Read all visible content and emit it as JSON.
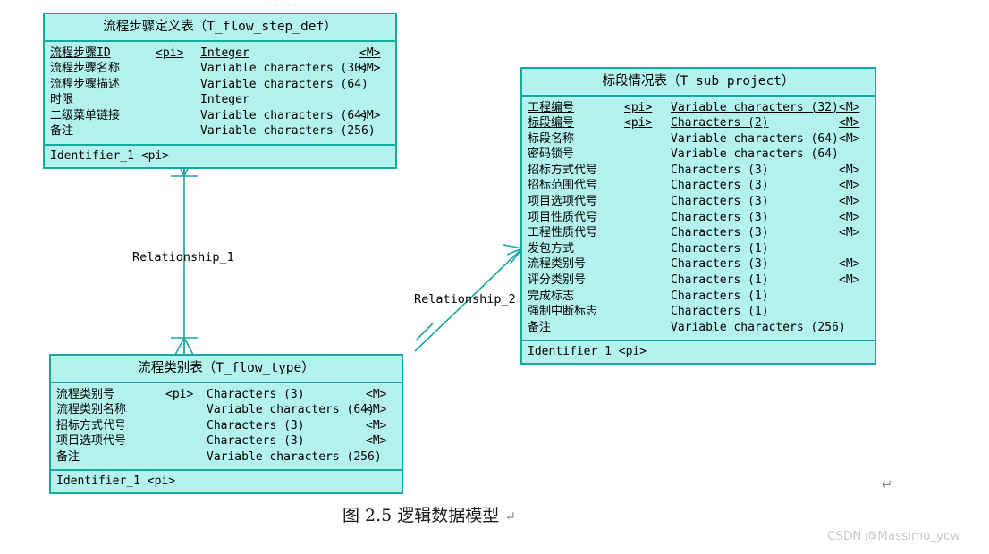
{
  "figure": {
    "caption": "图 2.5 逻辑数据模型",
    "caption_mark": "↵",
    "stray_mark": "↵",
    "watermark": "CSDN @Massimo_ycw",
    "colors": {
      "entity_fill": "#b4f2ee",
      "entity_border": "#17a8a0",
      "relationship_line": "#17a8a0",
      "text": "#000000",
      "watermark_text": "#c8c8c8"
    }
  },
  "entities": [
    {
      "id": "t_flow_step_def",
      "title": "流程步骤定义表（T_flow_step_def）",
      "identifier": "Identifier_1  <pi>",
      "attributes": [
        {
          "name": "流程步骤ID",
          "pi": "<pi>",
          "type": "Integer",
          "m": "<M>",
          "underline": true
        },
        {
          "name": "流程步骤名称",
          "pi": "",
          "type": "Variable characters (30)",
          "m": "<M>",
          "underline": false
        },
        {
          "name": "流程步骤描述",
          "pi": "",
          "type": "Variable characters (64)",
          "m": "",
          "underline": false
        },
        {
          "name": "时限",
          "pi": "",
          "type": "Integer",
          "m": "",
          "underline": false
        },
        {
          "name": "二级菜单链接",
          "pi": "",
          "type": "Variable characters (64)",
          "m": "<M>",
          "underline": false
        },
        {
          "name": "备注",
          "pi": "",
          "type": "Variable characters (256)",
          "m": "",
          "underline": false
        }
      ]
    },
    {
      "id": "t_sub_project",
      "title": "标段情况表（T_sub_project）",
      "identifier": "Identifier_1  <pi>",
      "attributes": [
        {
          "name": "工程编号",
          "pi": "<pi>",
          "type": "Variable characters (32)",
          "m": "<M>",
          "underline": true
        },
        {
          "name": "标段编号",
          "pi": "<pi>",
          "type": "Characters (2)",
          "m": "<M>",
          "underline": true
        },
        {
          "name": "标段名称",
          "pi": "",
          "type": "Variable characters (64)",
          "m": "<M>",
          "underline": false
        },
        {
          "name": "密码锁号",
          "pi": "",
          "type": "Variable characters (64)",
          "m": "",
          "underline": false
        },
        {
          "name": "招标方式代号",
          "pi": "",
          "type": "Characters (3)",
          "m": "<M>",
          "underline": false
        },
        {
          "name": "招标范围代号",
          "pi": "",
          "type": "Characters (3)",
          "m": "<M>",
          "underline": false
        },
        {
          "name": "项目选项代号",
          "pi": "",
          "type": "Characters (3)",
          "m": "<M>",
          "underline": false
        },
        {
          "name": "项目性质代号",
          "pi": "",
          "type": "Characters (3)",
          "m": "<M>",
          "underline": false
        },
        {
          "name": "工程性质代号",
          "pi": "",
          "type": "Characters (3)",
          "m": "<M>",
          "underline": false
        },
        {
          "name": "发包方式",
          "pi": "",
          "type": "Characters (1)",
          "m": "",
          "underline": false
        },
        {
          "name": "流程类别号",
          "pi": "",
          "type": "Characters (3)",
          "m": "<M>",
          "underline": false
        },
        {
          "name": "评分类别号",
          "pi": "",
          "type": "Characters (1)",
          "m": "<M>",
          "underline": false
        },
        {
          "name": "完成标志",
          "pi": "",
          "type": "Characters (1)",
          "m": "",
          "underline": false
        },
        {
          "name": "强制中断标志",
          "pi": "",
          "type": "Characters (1)",
          "m": "",
          "underline": false
        },
        {
          "name": "备注",
          "pi": "",
          "type": "Variable characters (256)",
          "m": "",
          "underline": false
        }
      ]
    },
    {
      "id": "t_flow_type",
      "title": "流程类别表（T_flow_type）",
      "identifier": "Identifier_1  <pi>",
      "attributes": [
        {
          "name": "流程类别号",
          "pi": "<pi>",
          "type": "Characters (3)",
          "m": "<M>",
          "underline": true
        },
        {
          "name": "流程类别名称",
          "pi": "",
          "type": "Variable characters (64)",
          "m": "<M>",
          "underline": false
        },
        {
          "name": "招标方式代号",
          "pi": "",
          "type": "Characters (3)",
          "m": "<M>",
          "underline": false
        },
        {
          "name": "项目选项代号",
          "pi": "",
          "type": "Characters (3)",
          "m": "<M>",
          "underline": false
        },
        {
          "name": "备注",
          "pi": "",
          "type": "Variable characters (256)",
          "m": "",
          "underline": false
        }
      ]
    }
  ],
  "relationships": [
    {
      "id": "relationship_1",
      "label": "Relationship_1",
      "from": "t_flow_step_def",
      "to": "t_flow_type"
    },
    {
      "id": "relationship_2",
      "label": "Relationship_2",
      "from": "t_flow_type",
      "to": "t_sub_project"
    }
  ]
}
